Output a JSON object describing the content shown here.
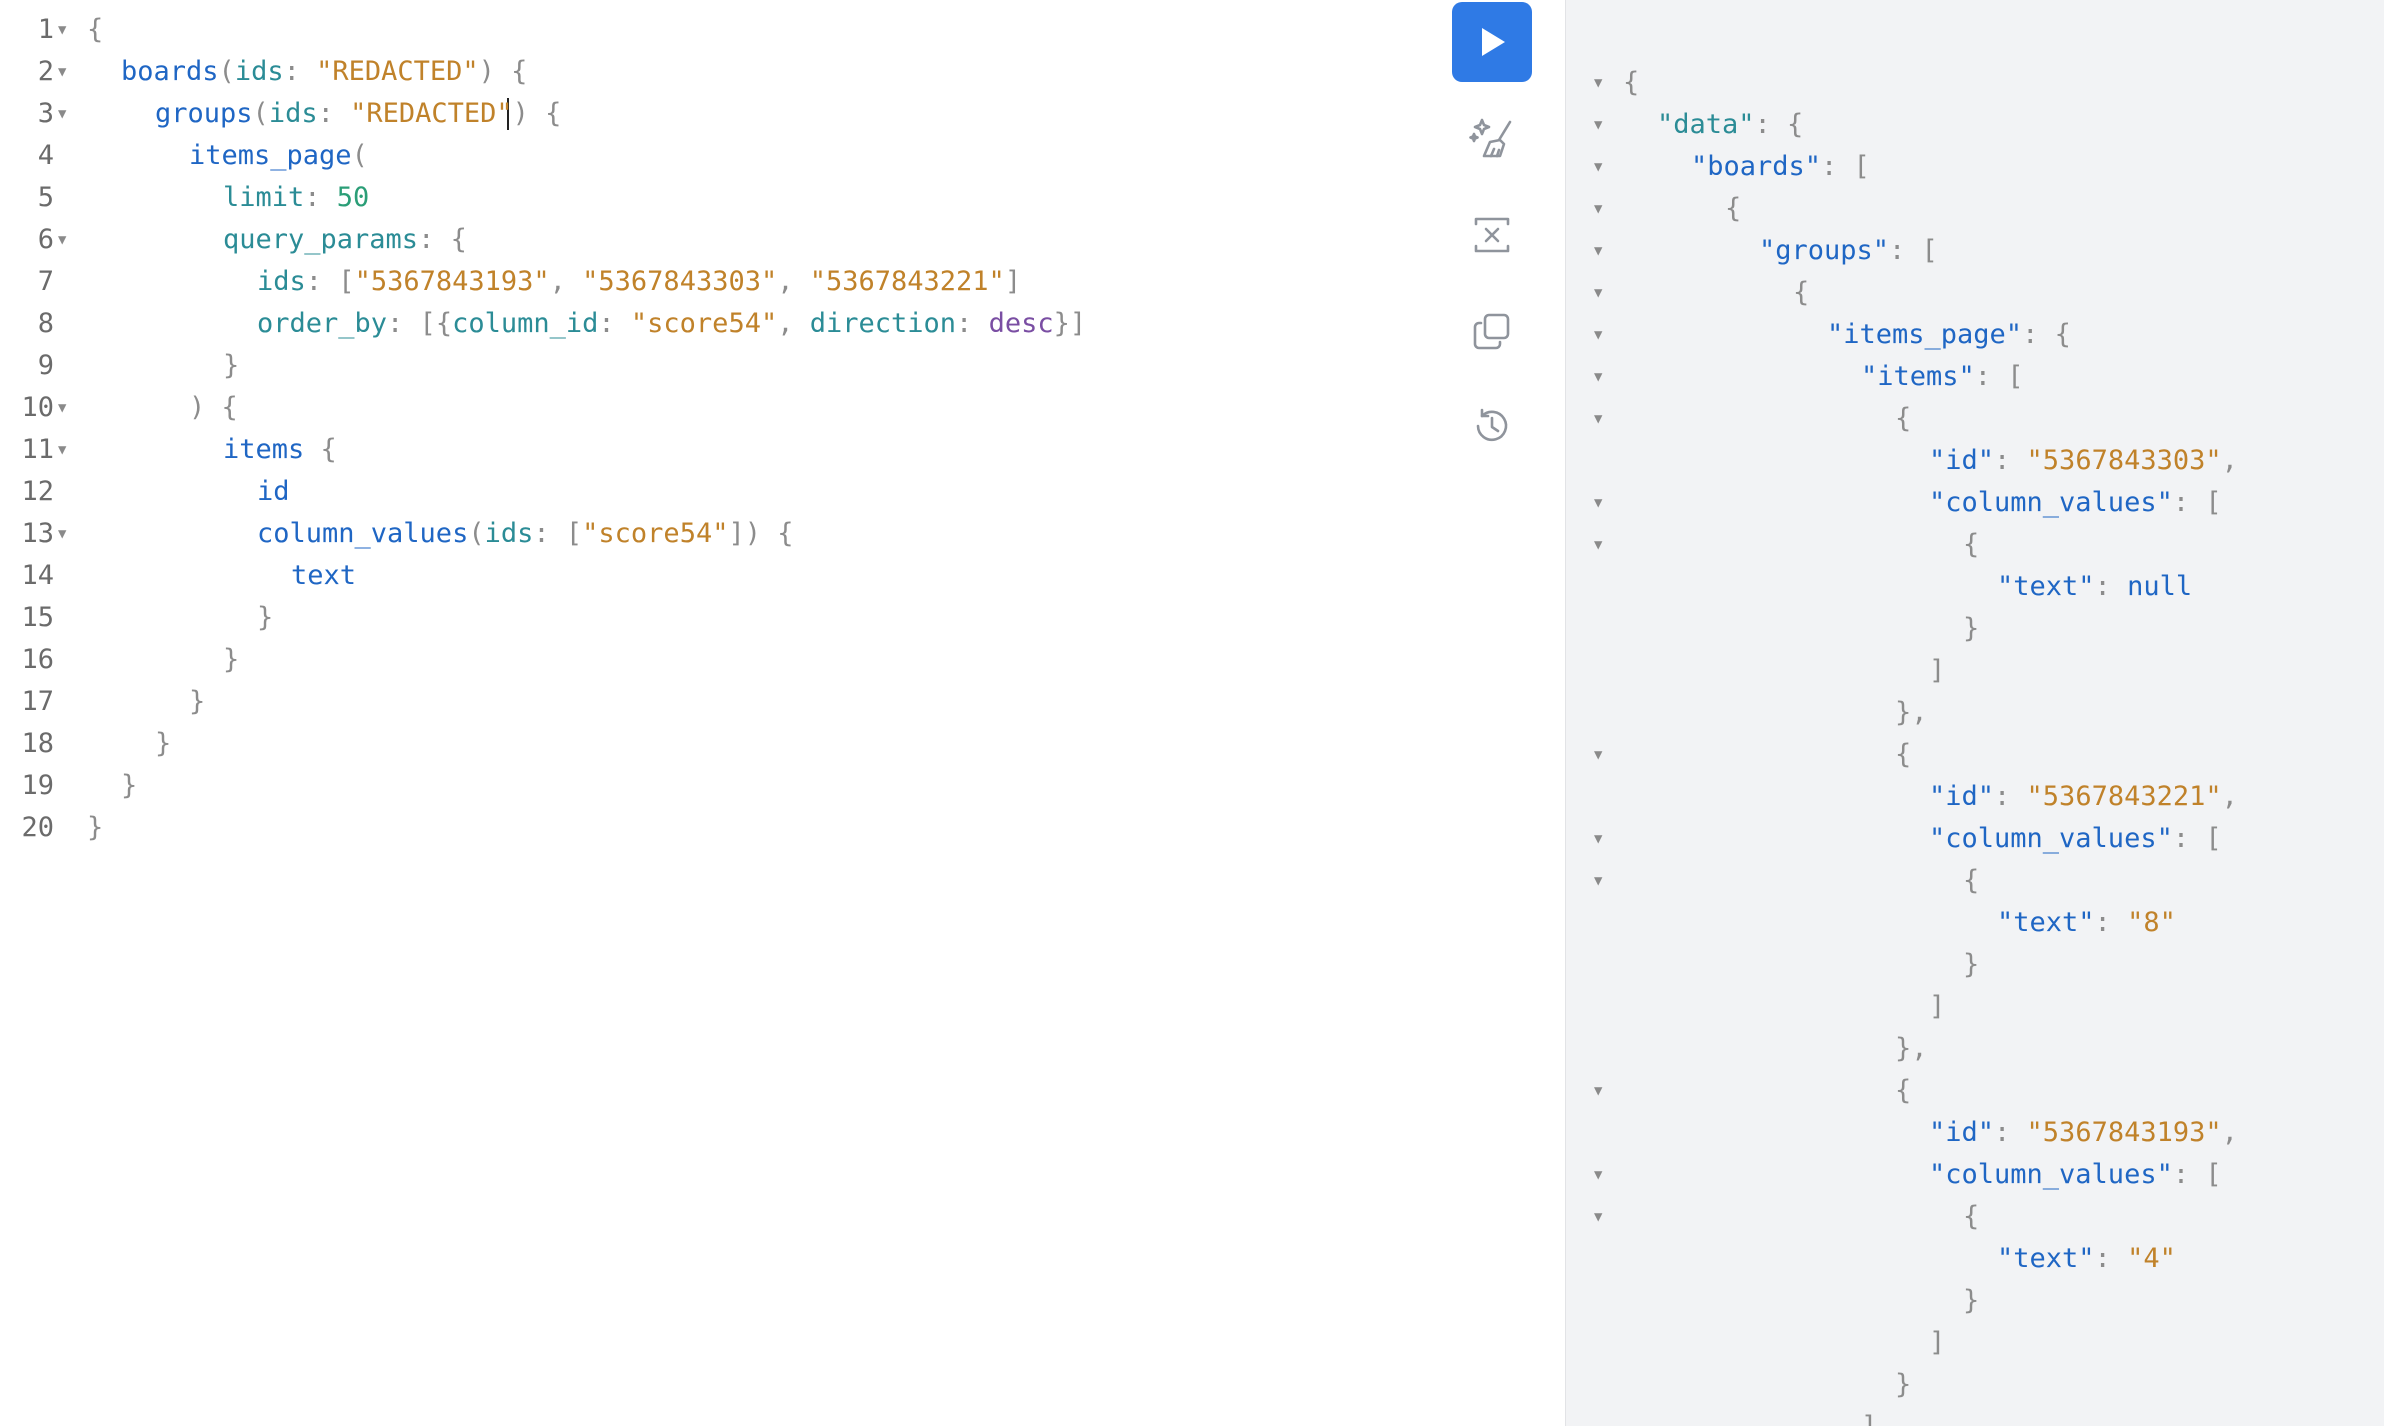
{
  "editor": {
    "lines": [
      {
        "n": "1",
        "fold": true,
        "indent": 0,
        "tokens": [
          [
            "{",
            "punct"
          ]
        ]
      },
      {
        "n": "2",
        "fold": true,
        "indent": 1,
        "tokens": [
          [
            "boards",
            "field"
          ],
          [
            "(",
            "punct"
          ],
          [
            "ids",
            "arg"
          ],
          [
            ": ",
            "punct"
          ],
          [
            "\"REDACTED\"",
            "str"
          ],
          [
            ") {",
            "punct"
          ]
        ]
      },
      {
        "n": "3",
        "fold": true,
        "indent": 2,
        "tokens": [
          [
            "groups",
            "field"
          ],
          [
            "(",
            "punct"
          ],
          [
            "ids",
            "arg"
          ],
          [
            ": ",
            "punct"
          ],
          [
            "\"REDACTED\"",
            "str"
          ],
          [
            ") {",
            "punct"
          ]
        ]
      },
      {
        "n": "4",
        "fold": false,
        "indent": 3,
        "tokens": [
          [
            "items_page",
            "field"
          ],
          [
            "(",
            "punct"
          ]
        ]
      },
      {
        "n": "5",
        "fold": false,
        "indent": 4,
        "tokens": [
          [
            "limit",
            "arg"
          ],
          [
            ": ",
            "punct"
          ],
          [
            "50",
            "num"
          ]
        ]
      },
      {
        "n": "6",
        "fold": true,
        "indent": 4,
        "tokens": [
          [
            "query_params",
            "arg"
          ],
          [
            ": {",
            "punct"
          ]
        ]
      },
      {
        "n": "7",
        "fold": false,
        "indent": 5,
        "tokens": [
          [
            "ids",
            "arg"
          ],
          [
            ": [",
            "punct"
          ],
          [
            "\"5367843193\"",
            "str"
          ],
          [
            ", ",
            "punct"
          ],
          [
            "\"5367843303\"",
            "str"
          ],
          [
            ", ",
            "punct"
          ],
          [
            "\"5367843221\"",
            "str"
          ],
          [
            "]",
            "punct"
          ]
        ]
      },
      {
        "n": "8",
        "fold": false,
        "indent": 5,
        "tokens": [
          [
            "order_by",
            "arg"
          ],
          [
            ": [{",
            "punct"
          ],
          [
            "column_id",
            "arg"
          ],
          [
            ": ",
            "punct"
          ],
          [
            "\"score54\"",
            "str"
          ],
          [
            ", ",
            "punct"
          ],
          [
            "direction",
            "arg"
          ],
          [
            ": ",
            "punct"
          ],
          [
            "desc",
            "enum"
          ],
          [
            "}]",
            "punct"
          ]
        ]
      },
      {
        "n": "9",
        "fold": false,
        "indent": 4,
        "tokens": [
          [
            "}",
            "punct"
          ]
        ]
      },
      {
        "n": "10",
        "fold": true,
        "indent": 3,
        "tokens": [
          [
            ") {",
            "punct"
          ]
        ]
      },
      {
        "n": "11",
        "fold": true,
        "indent": 4,
        "tokens": [
          [
            "items",
            "field"
          ],
          [
            " {",
            "punct"
          ]
        ]
      },
      {
        "n": "12",
        "fold": false,
        "indent": 5,
        "tokens": [
          [
            "id",
            "field"
          ]
        ]
      },
      {
        "n": "13",
        "fold": true,
        "indent": 5,
        "tokens": [
          [
            "column_values",
            "field"
          ],
          [
            "(",
            "punct"
          ],
          [
            "ids",
            "arg"
          ],
          [
            ": [",
            "punct"
          ],
          [
            "\"score54\"",
            "str"
          ],
          [
            "]) {",
            "punct"
          ]
        ]
      },
      {
        "n": "14",
        "fold": false,
        "indent": 6,
        "tokens": [
          [
            "text",
            "field"
          ]
        ]
      },
      {
        "n": "15",
        "fold": false,
        "indent": 5,
        "tokens": [
          [
            "}",
            "punct"
          ]
        ]
      },
      {
        "n": "16",
        "fold": false,
        "indent": 4,
        "tokens": [
          [
            "}",
            "punct"
          ]
        ]
      },
      {
        "n": "17",
        "fold": false,
        "indent": 3,
        "tokens": [
          [
            "}",
            "punct"
          ]
        ]
      },
      {
        "n": "18",
        "fold": false,
        "indent": 2,
        "tokens": [
          [
            "}",
            "punct"
          ]
        ]
      },
      {
        "n": "19",
        "fold": false,
        "indent": 1,
        "tokens": [
          [
            "}",
            "punct"
          ]
        ]
      },
      {
        "n": "20",
        "fold": false,
        "indent": 0,
        "tokens": [
          [
            "}",
            "punct"
          ]
        ]
      }
    ]
  },
  "toolbar": {
    "tools": [
      {
        "name": "run-button",
        "icon": "play-icon"
      },
      {
        "name": "prettify-button",
        "icon": "magic-wand-broom-icon"
      },
      {
        "name": "merge-fragments-button",
        "icon": "merge-icon"
      },
      {
        "name": "copy-query-button",
        "icon": "copy-icon"
      },
      {
        "name": "history-button",
        "icon": "history-icon"
      }
    ],
    "accent_color": "#2f7ae5"
  },
  "result": {
    "lines": [
      {
        "fold": true,
        "indent": 0,
        "tokens": [
          [
            "{",
            "punct"
          ]
        ]
      },
      {
        "fold": true,
        "indent": 1,
        "tokens": [
          [
            "\"data\"",
            "key0"
          ],
          [
            ": {",
            "punct"
          ]
        ]
      },
      {
        "fold": true,
        "indent": 2,
        "tokens": [
          [
            "\"boards\"",
            "key"
          ],
          [
            ": [",
            "punct"
          ]
        ]
      },
      {
        "fold": true,
        "indent": 3,
        "tokens": [
          [
            "{",
            "punct"
          ]
        ]
      },
      {
        "fold": true,
        "indent": 4,
        "tokens": [
          [
            "\"groups\"",
            "key"
          ],
          [
            ": [",
            "punct"
          ]
        ]
      },
      {
        "fold": true,
        "indent": 5,
        "tokens": [
          [
            "{",
            "punct"
          ]
        ]
      },
      {
        "fold": true,
        "indent": 6,
        "tokens": [
          [
            "\"items_page\"",
            "key"
          ],
          [
            ": {",
            "punct"
          ]
        ]
      },
      {
        "fold": true,
        "indent": 7,
        "tokens": [
          [
            "\"items\"",
            "key"
          ],
          [
            ": [",
            "punct"
          ]
        ]
      },
      {
        "fold": true,
        "indent": 8,
        "tokens": [
          [
            "{",
            "punct"
          ]
        ]
      },
      {
        "fold": false,
        "indent": 9,
        "tokens": [
          [
            "\"id\"",
            "key"
          ],
          [
            ": ",
            "punct"
          ],
          [
            "\"5367843303\"",
            "str"
          ],
          [
            ",",
            "punct"
          ]
        ]
      },
      {
        "fold": true,
        "indent": 9,
        "tokens": [
          [
            "\"column_values\"",
            "key"
          ],
          [
            ": [",
            "punct"
          ]
        ]
      },
      {
        "fold": true,
        "indent": 10,
        "tokens": [
          [
            "{",
            "punct"
          ]
        ]
      },
      {
        "fold": false,
        "indent": 11,
        "tokens": [
          [
            "\"text\"",
            "key"
          ],
          [
            ": ",
            "punct"
          ],
          [
            "null",
            "null"
          ]
        ]
      },
      {
        "fold": false,
        "indent": 10,
        "tokens": [
          [
            "}",
            "punct"
          ]
        ]
      },
      {
        "fold": false,
        "indent": 9,
        "tokens": [
          [
            "]",
            "punct"
          ]
        ]
      },
      {
        "fold": false,
        "indent": 8,
        "tokens": [
          [
            "},",
            "punct"
          ]
        ]
      },
      {
        "fold": true,
        "indent": 8,
        "tokens": [
          [
            "{",
            "punct"
          ]
        ]
      },
      {
        "fold": false,
        "indent": 9,
        "tokens": [
          [
            "\"id\"",
            "key"
          ],
          [
            ": ",
            "punct"
          ],
          [
            "\"5367843221\"",
            "str"
          ],
          [
            ",",
            "punct"
          ]
        ]
      },
      {
        "fold": true,
        "indent": 9,
        "tokens": [
          [
            "\"column_values\"",
            "key"
          ],
          [
            ": [",
            "punct"
          ]
        ]
      },
      {
        "fold": true,
        "indent": 10,
        "tokens": [
          [
            "{",
            "punct"
          ]
        ]
      },
      {
        "fold": false,
        "indent": 11,
        "tokens": [
          [
            "\"text\"",
            "key"
          ],
          [
            ": ",
            "punct"
          ],
          [
            "\"8\"",
            "str"
          ]
        ]
      },
      {
        "fold": false,
        "indent": 10,
        "tokens": [
          [
            "}",
            "punct"
          ]
        ]
      },
      {
        "fold": false,
        "indent": 9,
        "tokens": [
          [
            "]",
            "punct"
          ]
        ]
      },
      {
        "fold": false,
        "indent": 8,
        "tokens": [
          [
            "},",
            "punct"
          ]
        ]
      },
      {
        "fold": true,
        "indent": 8,
        "tokens": [
          [
            "{",
            "punct"
          ]
        ]
      },
      {
        "fold": false,
        "indent": 9,
        "tokens": [
          [
            "\"id\"",
            "key"
          ],
          [
            ": ",
            "punct"
          ],
          [
            "\"5367843193\"",
            "str"
          ],
          [
            ",",
            "punct"
          ]
        ]
      },
      {
        "fold": true,
        "indent": 9,
        "tokens": [
          [
            "\"column_values\"",
            "key"
          ],
          [
            ": [",
            "punct"
          ]
        ]
      },
      {
        "fold": true,
        "indent": 10,
        "tokens": [
          [
            "{",
            "punct"
          ]
        ]
      },
      {
        "fold": false,
        "indent": 11,
        "tokens": [
          [
            "\"text\"",
            "key"
          ],
          [
            ": ",
            "punct"
          ],
          [
            "\"4\"",
            "str"
          ]
        ]
      },
      {
        "fold": false,
        "indent": 10,
        "tokens": [
          [
            "}",
            "punct"
          ]
        ]
      },
      {
        "fold": false,
        "indent": 9,
        "tokens": [
          [
            "]",
            "punct"
          ]
        ]
      },
      {
        "fold": false,
        "indent": 8,
        "tokens": [
          [
            "}",
            "punct"
          ]
        ]
      },
      {
        "fold": false,
        "indent": 7,
        "tokens": [
          [
            "]",
            "punct"
          ]
        ]
      }
    ]
  }
}
